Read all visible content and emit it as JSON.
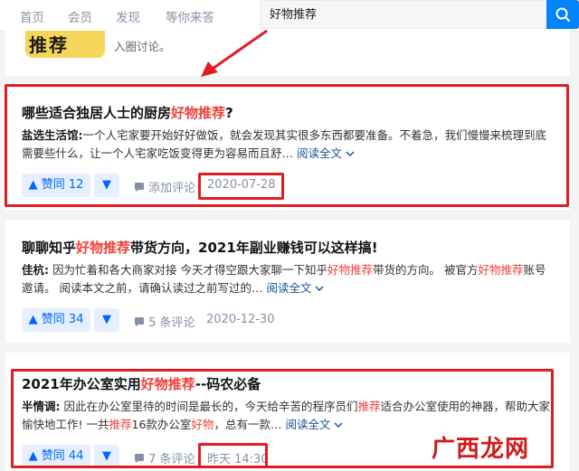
{
  "nav": {
    "items": [
      "首页",
      "会员",
      "发现",
      "等你来答"
    ]
  },
  "search": {
    "value": "好物推荐"
  },
  "top_card": {
    "thumb_text": "推荐",
    "snippet": "入圈讨论。"
  },
  "cards": [
    {
      "title_pre": "哪些适合独居人士的厨房",
      "title_hl": "好物推荐",
      "title_post": "?",
      "author": "盐选生活馆:",
      "excerpt": "一个人宅家要开始好好做饭，就会发现其实很多东西都要准备。不着急，我们慢慢来梳理到底需要些什么，让一个人宅家吃饭变得更为容易而且舒…",
      "read_more": "阅读全文",
      "vote": "▲ 赞同 12",
      "down": "▼",
      "comment": "添加评论",
      "date": "2020-07-28"
    },
    {
      "title_pre": "聊聊知乎",
      "title_hl": "好物推荐",
      "title_post": "带货方向，2021年副业赚钱可以这样搞!",
      "author": "佳杭:",
      "excerpt_a": "因为忙着和各大商家对接 今天才得空跟大家聊一下知乎",
      "excerpt_hl1": "好物推荐",
      "excerpt_b": "带货的方向。 被官方",
      "excerpt_hl2": "好物推荐",
      "excerpt_c": "账号邀请。 阅读本文之前，请确认读过之前写过的…",
      "read_more": "阅读全文",
      "vote": "▲ 赞同 34",
      "down": "▼",
      "comment": "5 条评论",
      "date": "2020-12-30"
    },
    {
      "title_pre": "2021年办公室实用",
      "title_hl": "好物推荐",
      "title_post": "--码农必备",
      "author": "半情调:",
      "excerpt_a": "因此在办公室里待的时间是最长的，今天给辛苦的程序员们",
      "excerpt_hl1": "推荐",
      "excerpt_b": "适合办公室使用的神器，帮助大家愉快地工作! 一共",
      "excerpt_hl2": "推荐",
      "excerpt_c": "16款办公室",
      "excerpt_hl3": "好物",
      "excerpt_d": "，总有一款…",
      "read_more": "阅读全文",
      "vote": "▲ 赞同 44",
      "down": "▼",
      "comment": "7 条评论",
      "date": "昨天 14:30"
    }
  ],
  "watermark": "广西龙网",
  "colors": {
    "accent": "#0084ff",
    "highlight": "#f1403c",
    "annotation": "#e31b23"
  }
}
